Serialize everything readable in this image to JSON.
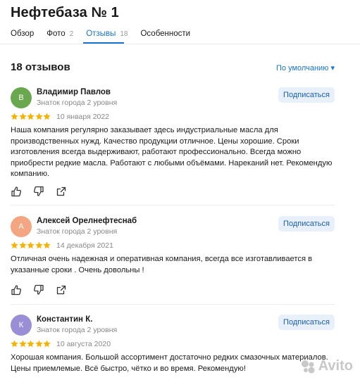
{
  "page": {
    "title": "Нефтебаза № 1"
  },
  "tabs": [
    {
      "label": "Обзор",
      "count": ""
    },
    {
      "label": "Фото",
      "count": "2"
    },
    {
      "label": "Отзывы",
      "count": "18"
    },
    {
      "label": "Особенности",
      "count": ""
    }
  ],
  "reviews_header": {
    "count_text": "18 отзывов",
    "sort_label": "По умолчанию ▾"
  },
  "colors": {
    "accent": "#1a73c8",
    "star": "#f5b301",
    "subscribe_bg": "#e8f0fb"
  },
  "reviews": [
    {
      "initial": "В",
      "avatar_color": "#6aa84f",
      "name": "Владимир Павлов",
      "rank": "Знаток города 2 уровня",
      "subscribe_label": "Подписаться",
      "rating": 5,
      "date": "10 января 2022",
      "text": "Наша компания регулярно заказывает здесь индустриальные масла для производственных нужд. Качество продукции отличное. Цены хорошие. Сроки изготовления всегда выдерживают, работают профессионально. Всегда можно приобрести редкие масла. Работают с любыми объёмами. Нареканий нет. Рекомендую компанию."
    },
    {
      "initial": "А",
      "avatar_color": "#f4a582",
      "name": "Алексей Орелнефтеснаб",
      "rank": "Знаток города 2 уровня",
      "subscribe_label": "Подписаться",
      "rating": 5,
      "date": "14 декабря 2021",
      "text": "Отличная очень надежная и оперативная компания, всегда все изготавливается в указанные сроки . Очень довольны !"
    },
    {
      "initial": "К",
      "avatar_color": "#9a8fd6",
      "name": "Константин К.",
      "rank": "Знаток города 2 уровня",
      "subscribe_label": "Подписаться",
      "rating": 5,
      "date": "10 августа 2020",
      "text": "Хорошая компания. Большой ассортимент достаточно редких смазочных материалов. Цены приемлемые. Всё быстро, чётко и во время. Рекомендую!"
    }
  ],
  "icons": {
    "like": "thumbs-up-icon",
    "dislike": "thumbs-down-icon",
    "share": "share-icon"
  },
  "watermark": "Avito"
}
